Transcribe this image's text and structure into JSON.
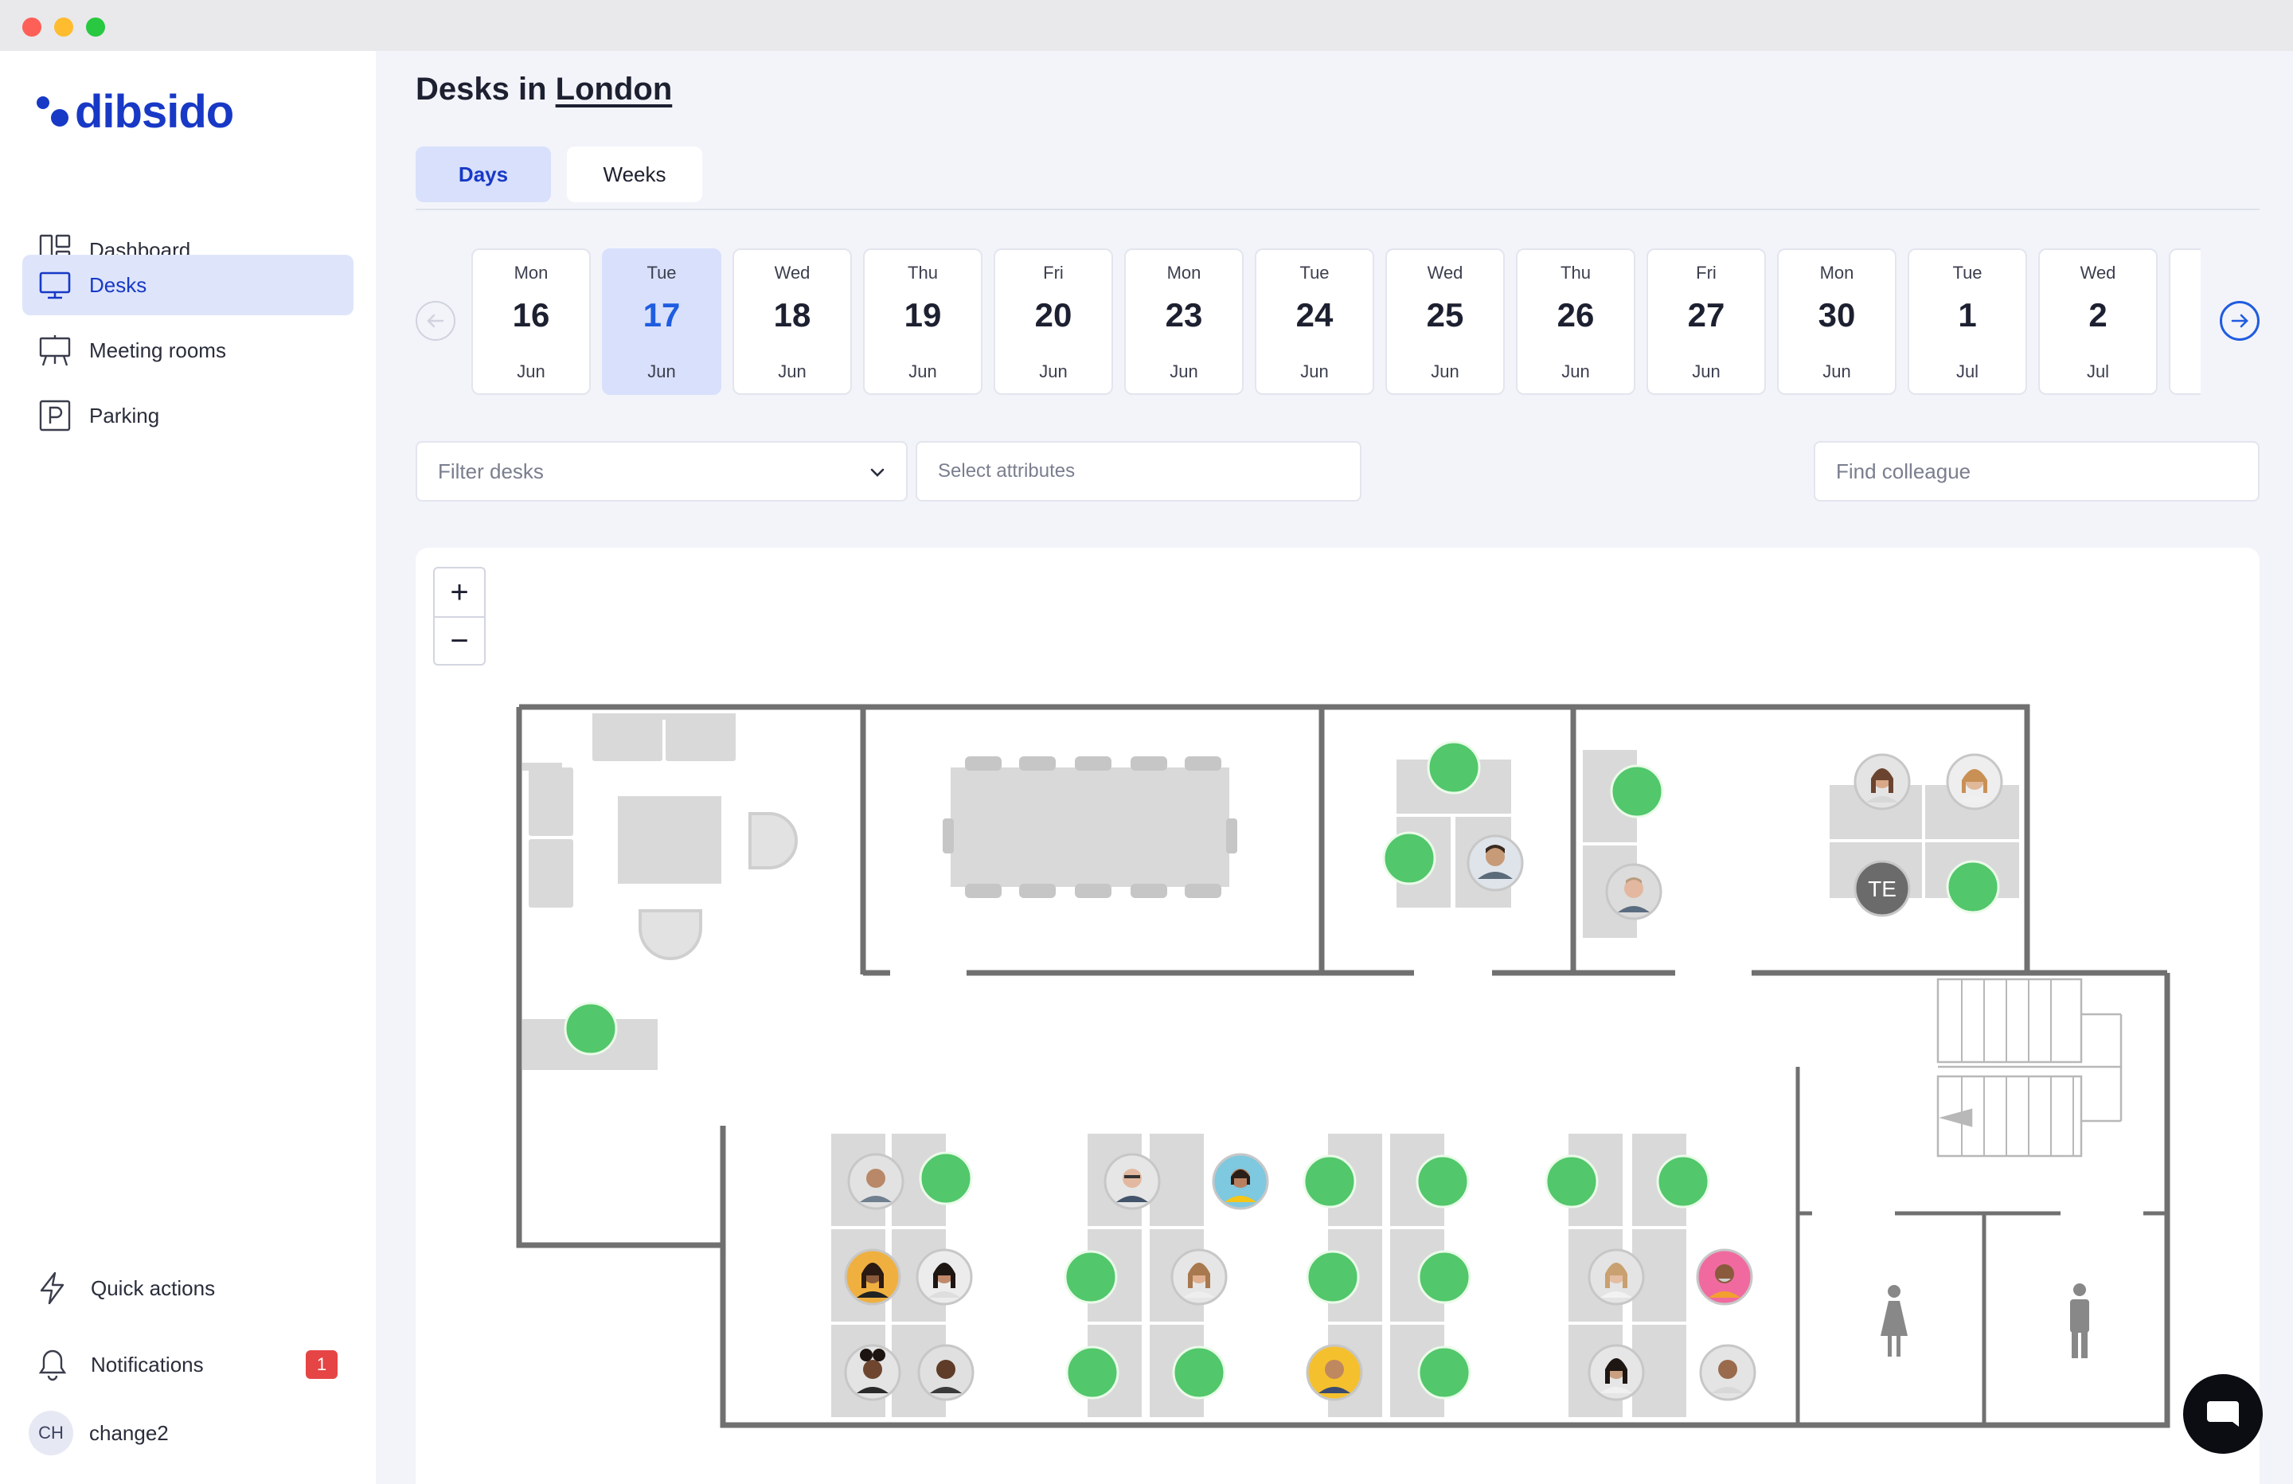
{
  "app": {
    "name": "dibsido"
  },
  "nav": {
    "items": [
      {
        "label": "Dashboard",
        "icon": "dashboard-icon"
      },
      {
        "label": "Desks",
        "icon": "monitor-icon",
        "active": true
      },
      {
        "label": "Meeting rooms",
        "icon": "presentation-board-icon"
      },
      {
        "label": "Parking",
        "icon": "parking-icon"
      }
    ]
  },
  "bottom_nav": {
    "quick_actions": "Quick actions",
    "notifications": "Notifications",
    "notifications_count": "1",
    "user_initials": "CH",
    "user_name": "change2"
  },
  "header": {
    "title_prefix": "Desks in",
    "location": "London"
  },
  "tabs": [
    {
      "label": "Days",
      "active": true
    },
    {
      "label": "Weeks"
    }
  ],
  "dates": [
    {
      "dow": "Mon",
      "num": "16",
      "mon": "Jun"
    },
    {
      "dow": "Tue",
      "num": "17",
      "mon": "Jun",
      "active": true
    },
    {
      "dow": "Wed",
      "num": "18",
      "mon": "Jun"
    },
    {
      "dow": "Thu",
      "num": "19",
      "mon": "Jun"
    },
    {
      "dow": "Fri",
      "num": "20",
      "mon": "Jun"
    },
    {
      "dow": "Mon",
      "num": "23",
      "mon": "Jun"
    },
    {
      "dow": "Tue",
      "num": "24",
      "mon": "Jun"
    },
    {
      "dow": "Wed",
      "num": "25",
      "mon": "Jun"
    },
    {
      "dow": "Thu",
      "num": "26",
      "mon": "Jun"
    },
    {
      "dow": "Fri",
      "num": "27",
      "mon": "Jun"
    },
    {
      "dow": "Mon",
      "num": "30",
      "mon": "Jun"
    },
    {
      "dow": "Tue",
      "num": "1",
      "mon": "Jul"
    },
    {
      "dow": "Wed",
      "num": "2",
      "mon": "Jul"
    }
  ],
  "filters": {
    "filter_desks_placeholder": "Filter desks",
    "attributes_placeholder": "Select attributes",
    "colleague_placeholder": "Find colleague"
  },
  "map": {
    "zoom_in": "+",
    "zoom_out": "−",
    "occupant_initials": "TE"
  },
  "colors": {
    "brand": "#1839c6",
    "accent": "#1f5ce0",
    "available": "#52c76b",
    "furniture": "#d9d9d9",
    "wall": "#707070",
    "badge": "#e64545"
  }
}
